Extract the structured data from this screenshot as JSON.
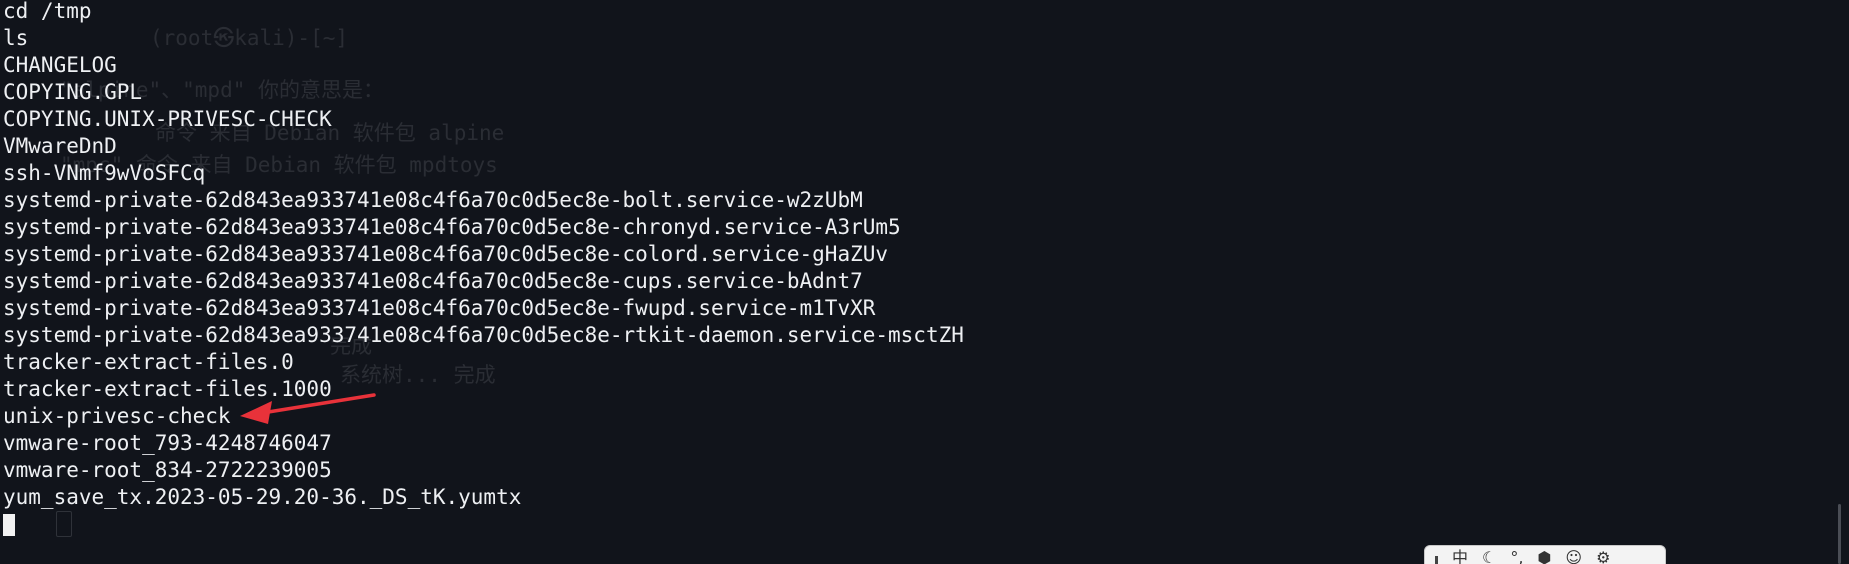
{
  "terminal": {
    "lines": [
      "cd /tmp",
      "ls",
      "CHANGELOG",
      "COPYING.GPL",
      "COPYING.UNIX-PRIVESC-CHECK",
      "VMwareDnD",
      "ssh-VNmf9wVoSFCq",
      "systemd-private-62d843ea933741e08c4f6a70c0d5ec8e-bolt.service-w2zUbM",
      "systemd-private-62d843ea933741e08c4f6a70c0d5ec8e-chronyd.service-A3rUm5",
      "systemd-private-62d843ea933741e08c4f6a70c0d5ec8e-colord.service-gHaZUv",
      "systemd-private-62d843ea933741e08c4f6a70c0d5ec8e-cups.service-bAdnt7",
      "systemd-private-62d843ea933741e08c4f6a70c0d5ec8e-fwupd.service-m1TvXR",
      "systemd-private-62d843ea933741e08c4f6a70c0d5ec8e-rtkit-daemon.service-msctZH",
      "tracker-extract-files.0",
      "tracker-extract-files.1000",
      "unix-privesc-check",
      "vmware-root_793-4248746047",
      "vmware-root_834-2722239005",
      "yum_save_tx.2023-05-29.20-36._DS_tK.yumtx"
    ],
    "highlighted_item": "unix-privesc-check"
  },
  "ghost_text": {
    "line1": "(root㉿kali)-[~]",
    "line2": "\"alpine\"、\"mpd\" 你的意思是：",
    "line3": "命令 来自 Debian 软件包 alpine",
    "line4": "\"mpc\" 命令 来自 Debian 软件包 mpdtoys",
    "line5": "完成",
    "line6": "系统树... 完成"
  },
  "ime_toolbar": {
    "items": [
      "中",
      "☾",
      "°,",
      "⬢",
      "☺",
      "⚙"
    ]
  },
  "colors": {
    "background": "#11141b",
    "text": "#eef0f3",
    "arrow": "#e8323a"
  }
}
